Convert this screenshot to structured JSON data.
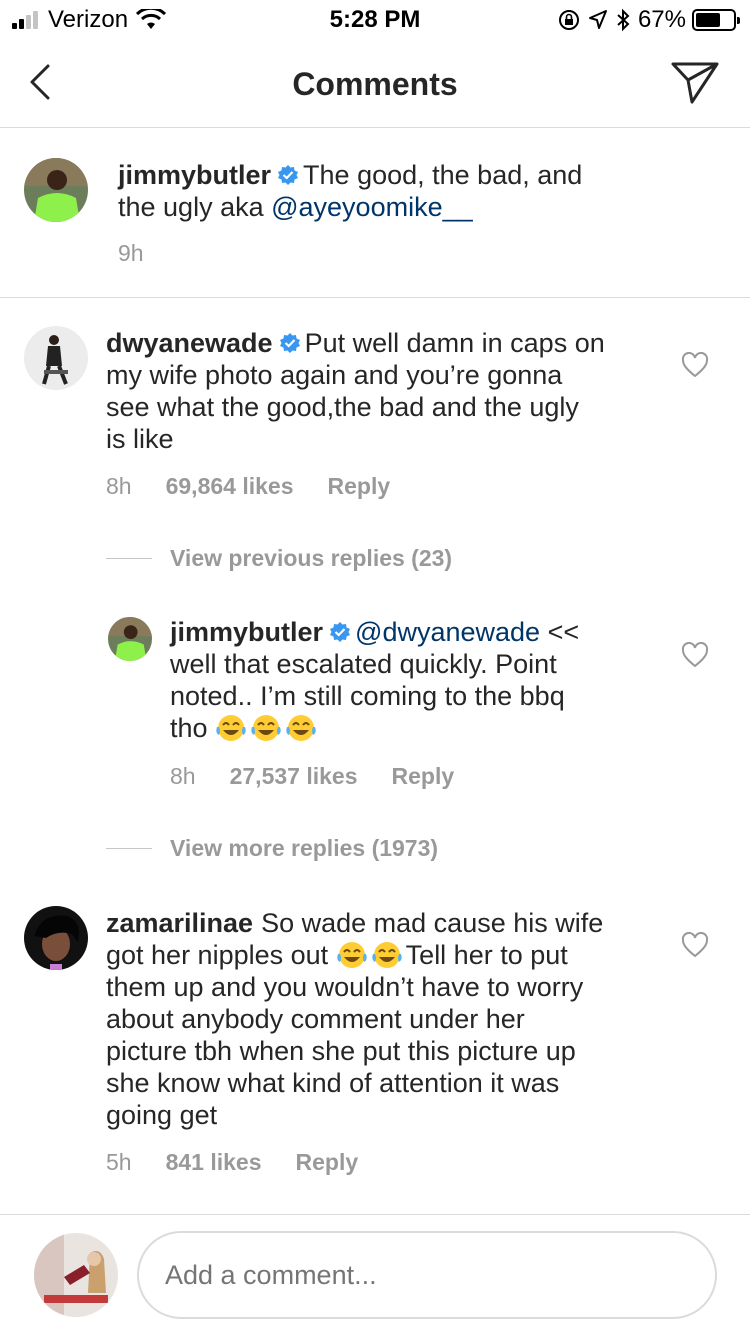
{
  "status_bar": {
    "carrier": "Verizon",
    "time": "5:28 PM",
    "battery_percent": "67%",
    "battery_level": 0.67,
    "signal_bars": 4,
    "signal_bars_active": 2
  },
  "nav": {
    "title": "Comments",
    "back_icon": "chevron-left-icon",
    "send_icon": "direct-send-icon"
  },
  "caption": {
    "username": "jimmybutler",
    "text": "The good, the bad, and",
    "text_line2": "the ugly aka ",
    "mention": "@ayeyoomike__",
    "time": "9h"
  },
  "comments": [
    {
      "username": "dwyanewade",
      "line1": "Put well damn in caps on",
      "lines": [
        "my wife photo again and you’re gonna",
        "see what the good,the bad and the ugly",
        "is like"
      ],
      "time": "8h",
      "likes": "69,864 likes",
      "reply": "Reply"
    },
    {
      "username": "zamarilinae",
      "line1": "So wade mad cause his wife",
      "line2_start": "got her nipples out ",
      "line2_end": "Tell her to put",
      "lines": [
        "them up and you wouldn’t have to worry",
        "about anybody comment under her",
        "picture tbh when she put this picture up",
        "she know what kind of attention it was",
        "going get"
      ],
      "time": "5h",
      "likes": "841 likes",
      "reply": "Reply"
    }
  ],
  "view_previous_replies": "View previous replies (23)",
  "reply": {
    "username": "jimmybutler",
    "mention": "@dwyanewade",
    "line1_end": " <<",
    "lines": [
      "well that escalated quickly. Point",
      "noted.. I’m still coming to the bbq"
    ],
    "last_line_start": "tho ",
    "time": "8h",
    "likes": "27,537 likes",
    "reply": "Reply"
  },
  "view_more_replies": "View more replies (1973)",
  "composer": {
    "placeholder": "Add a comment..."
  },
  "colors": {
    "verified": "#3897f0",
    "mention": "#003569",
    "muted": "#999999",
    "divider": "#dbdbdb"
  }
}
